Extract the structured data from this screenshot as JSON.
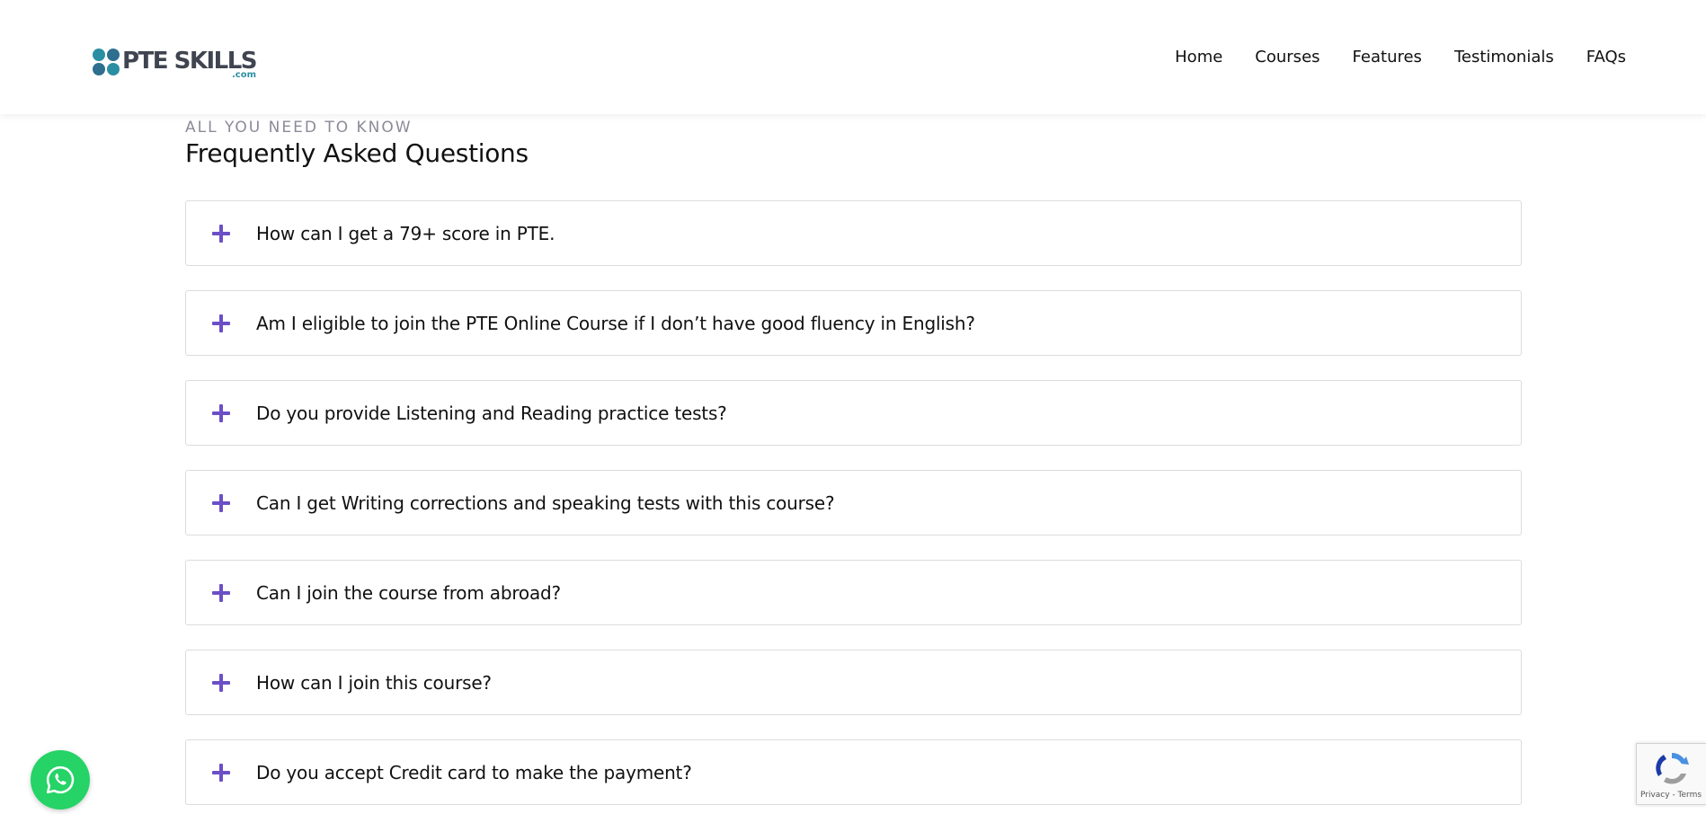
{
  "header": {
    "logo": {
      "brand": "PTE SKILLS",
      "sub": ".com"
    },
    "nav": [
      {
        "label": "Home"
      },
      {
        "label": "Courses"
      },
      {
        "label": "Features"
      },
      {
        "label": "Testimonials"
      },
      {
        "label": "FAQs"
      }
    ]
  },
  "faq": {
    "eyebrow": "ALL YOU NEED TO KNOW",
    "title": "Frequently Asked Questions",
    "items": [
      {
        "question": "How can I get a 79+ score in PTE."
      },
      {
        "question": "Am I eligible to join the PTE Online Course if I don’t have good fluency in English?"
      },
      {
        "question": "Do you provide Listening and Reading practice tests?"
      },
      {
        "question": "Can I get Writing corrections and speaking tests with this course?"
      },
      {
        "question": "Can I join the course from abroad?"
      },
      {
        "question": "How can I join this course?"
      },
      {
        "question": "Do you accept Credit card to make the payment?"
      }
    ]
  },
  "recaptcha": {
    "links": "Privacy - Terms"
  },
  "colors": {
    "accent": "#6b4fc6",
    "whatsapp": "#25d366",
    "brand": "#2b8fa3"
  }
}
